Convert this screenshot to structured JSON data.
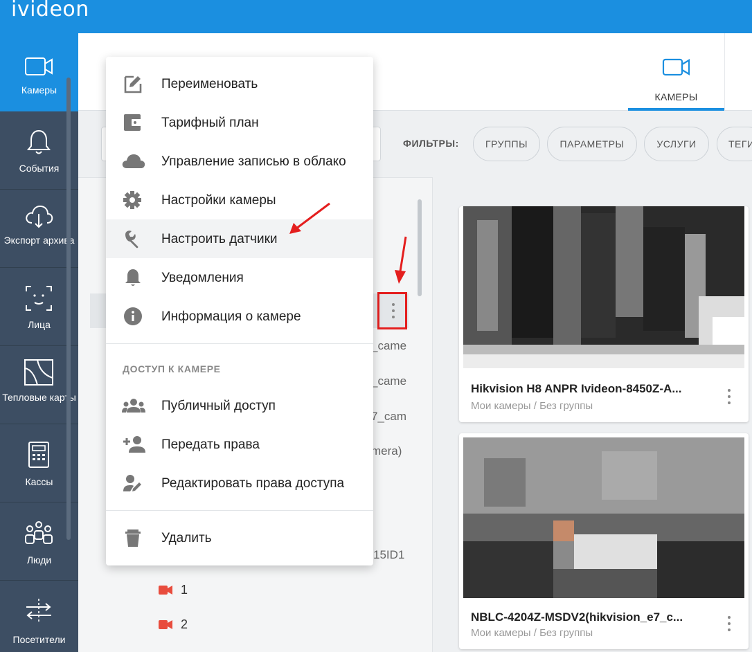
{
  "app": {
    "logo": "ivideon"
  },
  "sidebar": {
    "items": [
      {
        "label": "Камеры",
        "icon": "camera-icon",
        "active": true
      },
      {
        "label": "События",
        "icon": "bell-icon"
      },
      {
        "label": "Экспорт архива",
        "icon": "cloud-download-icon"
      },
      {
        "label": "Лица",
        "icon": "face-icon"
      },
      {
        "label": "Тепловые карты",
        "icon": "heatmap-icon"
      },
      {
        "label": "Кассы",
        "icon": "cash-register-icon"
      },
      {
        "label": "Люди",
        "icon": "people-icon"
      },
      {
        "label": "Посетители",
        "icon": "visitors-icon"
      }
    ]
  },
  "header": {
    "tab": {
      "label": "КАМЕРЫ",
      "icon": "camera-icon"
    }
  },
  "filters": {
    "label": "ФИЛЬТРЫ:",
    "chips": [
      "ГРУППЫ",
      "ПАРАМЕТРЫ",
      "УСЛУГИ",
      "ТЕГИ"
    ]
  },
  "list": {
    "partial_texts": [
      "_came",
      "_came",
      "7_cam",
      "mera)",
      "15ID1"
    ],
    "sub_items": [
      "1",
      "2"
    ]
  },
  "menu": {
    "items": [
      {
        "label": "Переименовать",
        "icon": "edit-icon"
      },
      {
        "label": "Тарифный план",
        "icon": "wallet-icon"
      },
      {
        "label": "Управление записью в облако",
        "icon": "cloud-icon"
      },
      {
        "label": "Настройки камеры",
        "icon": "gear-icon"
      },
      {
        "label": "Настроить датчики",
        "icon": "wrench-icon",
        "hover": true
      },
      {
        "label": "Уведомления",
        "icon": "bell-icon"
      },
      {
        "label": "Информация о камере",
        "icon": "info-icon"
      }
    ],
    "section_title": "ДОСТУП К КАМЕРЕ",
    "access_items": [
      {
        "label": "Публичный доступ",
        "icon": "group-icon"
      },
      {
        "label": "Передать права",
        "icon": "person-add-icon"
      },
      {
        "label": "Редактировать права доступа",
        "icon": "person-edit-icon"
      }
    ],
    "delete": {
      "label": "Удалить",
      "icon": "trash-icon"
    }
  },
  "cards": [
    {
      "title": "Hikvision H8 ANPR Ivideon-8450Z-A...",
      "subtitle": "Мои камеры / Без группы"
    },
    {
      "title": "NBLC-4204Z-MSDV2(hikvision_e7_c...",
      "subtitle": "Мои камеры / Без группы"
    }
  ],
  "colors": {
    "accent": "#1b8fe0",
    "sidebar": "#3d4e63",
    "highlight_box": "#e41e1e",
    "camera_offline": "#e84c3d"
  }
}
